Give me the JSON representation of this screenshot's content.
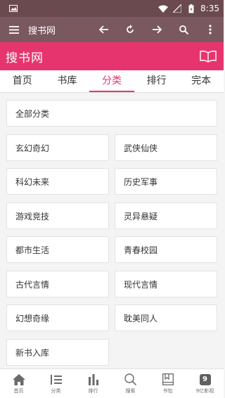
{
  "status_bar": {
    "time": "8:35",
    "icons": [
      "image-icon",
      "wifi-icon",
      "signal-icon",
      "battery-icon"
    ]
  },
  "toolbar": {
    "title": "搜书网",
    "actions": [
      "back-arrow-icon",
      "refresh-icon",
      "forward-arrow-icon",
      "search-icon",
      "more-icon"
    ]
  },
  "header": {
    "site_title": "搜书网"
  },
  "tabs": [
    {
      "label": "首页"
    },
    {
      "label": "书库"
    },
    {
      "label": "分类",
      "active": true
    },
    {
      "label": "排行"
    },
    {
      "label": "完本"
    }
  ],
  "categories": {
    "all": "全部分类",
    "items": [
      "玄幻奇幻",
      "武侠仙侠",
      "科幻未来",
      "历史军事",
      "游戏竞技",
      "灵异悬疑",
      "都市生活",
      "青春校园",
      "古代言情",
      "现代言情",
      "幻想奇缘",
      "耽美同人",
      "新书入库"
    ]
  },
  "bottom_nav": [
    {
      "label": "首页",
      "icon": "home-icon"
    },
    {
      "label": "分类",
      "icon": "list-icon"
    },
    {
      "label": "排行",
      "icon": "bar-chart-icon"
    },
    {
      "label": "搜索",
      "icon": "search-icon"
    },
    {
      "label": "书包",
      "icon": "bookbag-icon"
    },
    {
      "label": "9亿影视",
      "icon": "video-app-icon",
      "icon_text": "9"
    }
  ],
  "colors": {
    "accent": "#e6356e",
    "toolbar": "#7a5860",
    "status_bar": "#6b4a4f"
  }
}
